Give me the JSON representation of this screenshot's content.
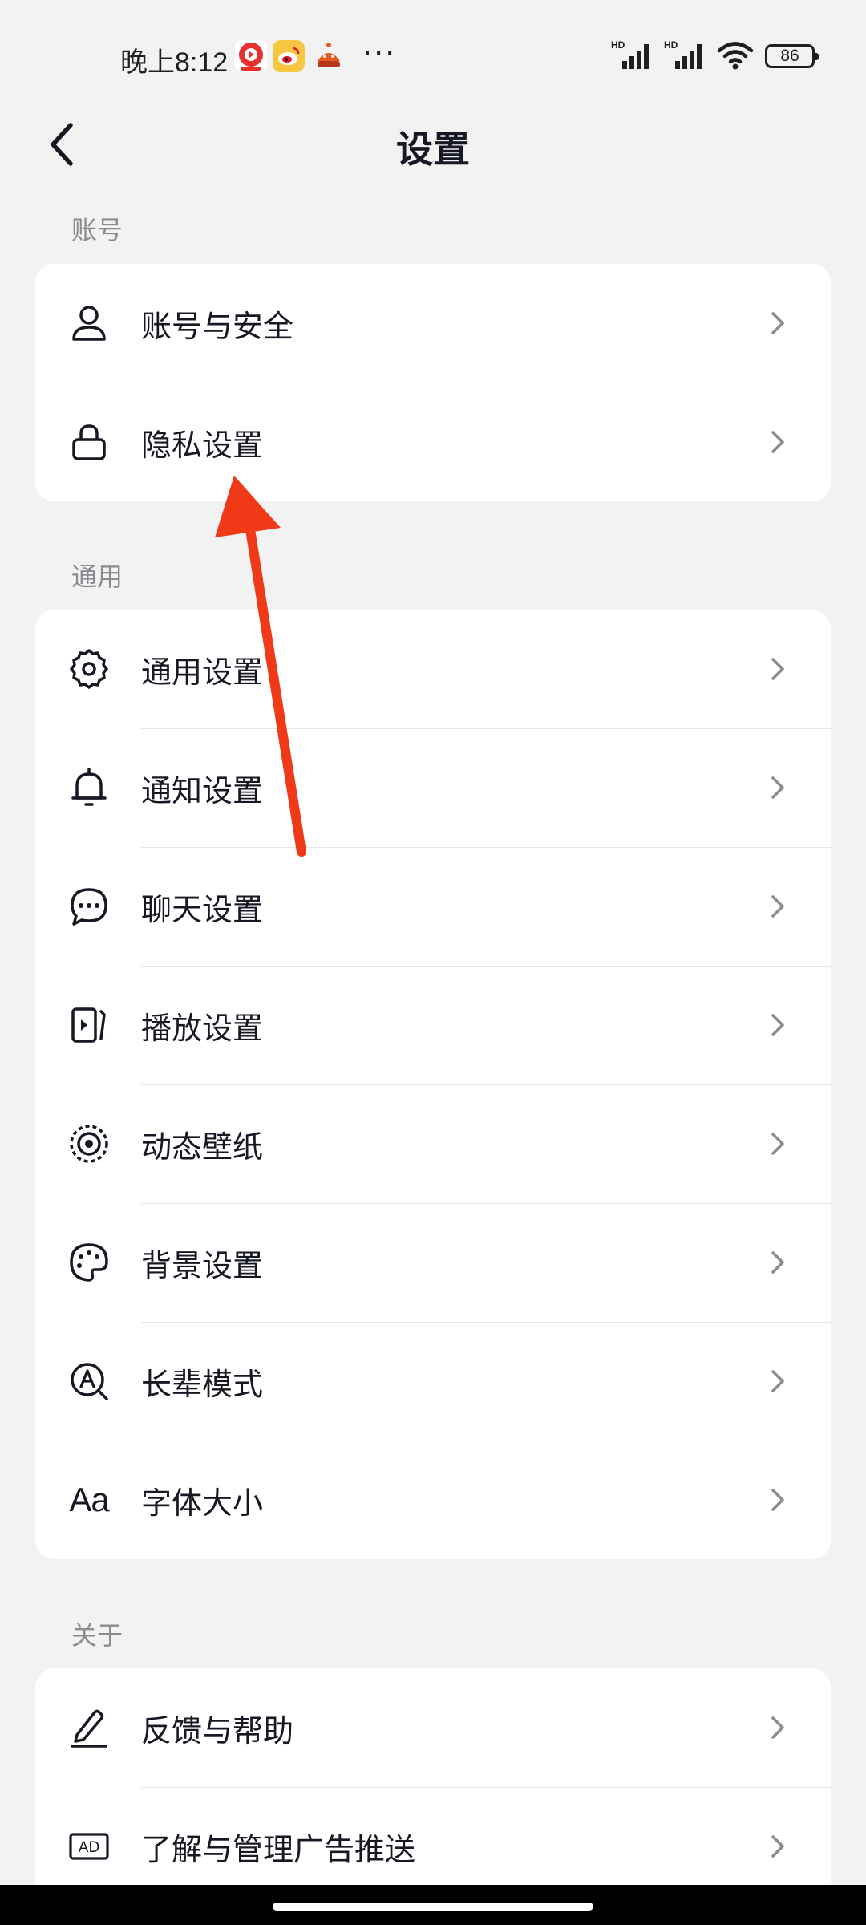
{
  "status_bar": {
    "time": "晚上8:12",
    "network_1": "HD",
    "network_2": "HD",
    "battery": "86",
    "more": "···"
  },
  "header": {
    "title": "设置"
  },
  "sections": {
    "account": {
      "title": "账号",
      "items": [
        {
          "label": "账号与安全",
          "icon": "user-icon"
        },
        {
          "label": "隐私设置",
          "icon": "lock-icon"
        }
      ]
    },
    "general": {
      "title": "通用",
      "items": [
        {
          "label": "通用设置",
          "icon": "gear-icon"
        },
        {
          "label": "通知设置",
          "icon": "bell-icon"
        },
        {
          "label": "聊天设置",
          "icon": "chat-icon"
        },
        {
          "label": "播放设置",
          "icon": "play-icon"
        },
        {
          "label": "动态壁纸",
          "icon": "wallpaper-icon"
        },
        {
          "label": "背景设置",
          "icon": "palette-icon"
        },
        {
          "label": "长辈模式",
          "icon": "elder-mode-icon"
        },
        {
          "label": "字体大小",
          "icon": "font-size-icon",
          "icon_text": "Aa"
        }
      ]
    },
    "about": {
      "title": "关于",
      "items": [
        {
          "label": "反馈与帮助",
          "icon": "pencil-icon"
        },
        {
          "label": "了解与管理广告推送",
          "icon": "ad-icon",
          "icon_text": "AD"
        }
      ]
    }
  },
  "colors": {
    "background": "#f2f2f2",
    "card": "#ffffff",
    "text": "#161823",
    "section_title": "#8a8b91",
    "chevron": "#8a8b91",
    "annotation_arrow": "#f03a17"
  }
}
